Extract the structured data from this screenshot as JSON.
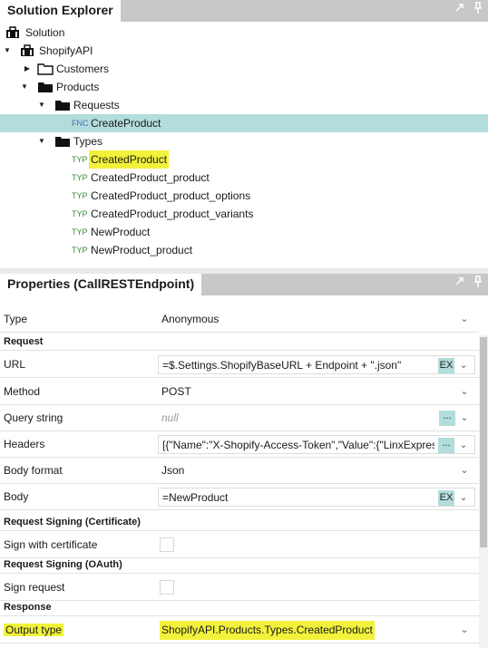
{
  "solution_explorer": {
    "title": "Solution Explorer",
    "pin_icon": "pin-icon",
    "float_icon": "float-icon",
    "tree": [
      {
        "label": "Solution",
        "icon": "solution-icon"
      },
      {
        "label": "ShopifyAPI",
        "icon": "project-icon",
        "expanded": true
      },
      {
        "label": "Customers",
        "icon": "folder-icon",
        "expanded": false
      },
      {
        "label": "Products",
        "icon": "folder-open-icon",
        "expanded": true
      },
      {
        "label": "Requests",
        "icon": "folder-open-icon",
        "expanded": true
      },
      {
        "label": "CreateProduct",
        "tag": "FNC",
        "selected": true
      },
      {
        "label": "Types",
        "icon": "folder-open-icon",
        "expanded": true
      },
      {
        "label": "CreatedProduct",
        "tag": "TYP",
        "highlighted": true
      },
      {
        "label": "CreatedProduct_product",
        "tag": "TYP"
      },
      {
        "label": "CreatedProduct_product_options",
        "tag": "TYP"
      },
      {
        "label": "CreatedProduct_product_variants",
        "tag": "TYP"
      },
      {
        "label": "NewProduct",
        "tag": "TYP"
      },
      {
        "label": "NewProduct_product",
        "tag": "TYP"
      }
    ]
  },
  "properties": {
    "title": "Properties (CallRESTEndpoint)",
    "rows": {
      "type": {
        "label": "Type",
        "value": "Anonymous"
      },
      "request_section": "Request",
      "url": {
        "label": "URL",
        "value": "=$.Settings.ShopifyBaseURL + Endpoint + \".json\"",
        "button": "EX"
      },
      "method": {
        "label": "Method",
        "value": "POST"
      },
      "query_string": {
        "label": "Query string",
        "placeholder": "null",
        "button": "..."
      },
      "headers": {
        "label": "Headers",
        "value": "[{\"Name\":\"X-Shopify-Access-Token\",\"Value\":{\"LinxExpress",
        "button": "..."
      },
      "body_format": {
        "label": "Body format",
        "value": "Json"
      },
      "body": {
        "label": "Body",
        "value": "=NewProduct",
        "button": "EX"
      },
      "signing_cert_section": "Request Signing (Certificate)",
      "sign_with_certificate": {
        "label": "Sign with certificate",
        "checked": false
      },
      "signing_oauth_section": "Request Signing (OAuth)",
      "sign_request": {
        "label": "Sign request",
        "checked": false
      },
      "response_section": "Response",
      "output_type": {
        "label": "Output type",
        "value": "ShopifyAPI.Products.Types.CreatedProduct",
        "highlighted": true
      }
    }
  },
  "colors": {
    "header_bg": "#c8c8c8",
    "selection": "#b3dcdc",
    "highlight": "#f2f23c",
    "typ_tag": "#3a8a3a",
    "fnc_tag": "#4870b8"
  }
}
